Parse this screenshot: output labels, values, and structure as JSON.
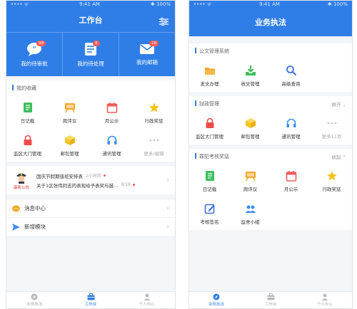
{
  "left": {
    "status": {
      "left": "•••• ᯤ",
      "time": "9:41 AM",
      "right": "✱ 100%"
    },
    "header": {
      "title": "工作台"
    },
    "quick": [
      {
        "label": "我的待审批",
        "badge": "99",
        "icon": "chat-bubble-icon"
      },
      {
        "label": "我的待处理",
        "badge": "6",
        "icon": "document-icon"
      },
      {
        "label": "我的邮箱",
        "badge": "10",
        "icon": "mail-icon"
      }
    ],
    "favorites": {
      "title": "我的收藏",
      "items": [
        {
          "label": "日记载",
          "icon": "diary-icon",
          "color": "#3cbf5c"
        },
        {
          "label": "周评议",
          "icon": "easel-icon",
          "color": "#f5a623"
        },
        {
          "label": "月公示",
          "icon": "calendar-icon",
          "color": "#f05a5a"
        },
        {
          "label": "行政奖惩",
          "icon": "star-icon",
          "color": "#f5c518"
        },
        {
          "label": "监区大门管理",
          "icon": "lock-icon",
          "color": "#ef4b4b"
        },
        {
          "label": "邮包管理",
          "icon": "package-icon",
          "color": "#f7c325"
        },
        {
          "label": "通讯管理",
          "icon": "headset-icon",
          "color": "#3d8ef0"
        },
        {
          "label": "更多/编辑",
          "icon": "more-dots-icon",
          "color": "#c8c8c8"
        }
      ]
    },
    "notice": {
      "tag": "最新公告",
      "lines": [
        {
          "text": "国庆节假期值班安排表",
          "meta": "2小时前"
        },
        {
          "text": "关于1区张伟同志的表现给予表奖与鼓...",
          "meta": "9/18"
        }
      ]
    },
    "rows": [
      {
        "label": "消息中心",
        "icon": "message-icon"
      },
      {
        "label": "新增模块",
        "icon": "send-icon"
      }
    ],
    "tabs": [
      {
        "label": "业务执法",
        "icon": "compass-icon",
        "active": false
      },
      {
        "label": "工作台",
        "icon": "briefcase-icon",
        "active": true
      },
      {
        "label": "个人中心",
        "icon": "person-icon",
        "active": false
      }
    ]
  },
  "right": {
    "status": {
      "left": "•••• ᯤ",
      "time": "9:41 AM",
      "right": "✱ 100%"
    },
    "header": {
      "title": "业务执法"
    },
    "sections": [
      {
        "title": "公文管理系统",
        "action": "",
        "items": [
          {
            "label": "发文办理",
            "icon": "folder-icon",
            "color": "#f5a623"
          },
          {
            "label": "收文管理",
            "icon": "inbox-download-icon",
            "color": "#3cbf5c"
          },
          {
            "label": "高级查询",
            "icon": "search-icon",
            "color": "#3d6fe0"
          }
        ]
      },
      {
        "title": "狱政管理",
        "action": "展开",
        "items": [
          {
            "label": "监区大门管理",
            "icon": "lock-icon",
            "color": "#ef4b4b"
          },
          {
            "label": "邮包管理",
            "icon": "package-icon",
            "color": "#f7c325"
          },
          {
            "label": "通讯管理",
            "icon": "headset-icon",
            "color": "#3d8ef0"
          },
          {
            "label": "更多11项",
            "icon": "more-dots-icon",
            "color": "#c8c8c8"
          }
        ]
      },
      {
        "title": "罪犯考核奖惩",
        "action": "收起",
        "items": [
          {
            "label": "日记载",
            "icon": "diary-icon",
            "color": "#3cbf5c"
          },
          {
            "label": "周评议",
            "icon": "easel-icon",
            "color": "#f5a623"
          },
          {
            "label": "月公示",
            "icon": "calendar-icon",
            "color": "#f05a5a"
          },
          {
            "label": "行政奖惩",
            "icon": "star-icon",
            "color": "#f5c518"
          },
          {
            "label": "考核签名",
            "icon": "sign-pen-icon",
            "color": "#3d6fe0"
          },
          {
            "label": "监舍小组",
            "icon": "group-icon",
            "color": "#3d8ef0"
          }
        ]
      }
    ],
    "tabs": [
      {
        "label": "业务执法",
        "icon": "compass-icon",
        "active": true
      },
      {
        "label": "工作台",
        "icon": "briefcase-icon",
        "active": false
      },
      {
        "label": "个人中心",
        "icon": "person-icon",
        "active": false
      }
    ]
  },
  "theme": {
    "primary": "#2f7ee8",
    "badge": "#ff5b5b"
  }
}
